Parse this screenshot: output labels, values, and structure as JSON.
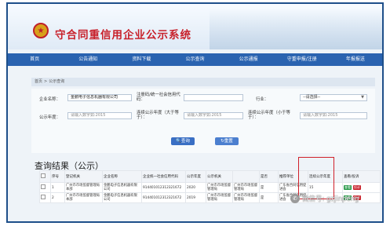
{
  "header": {
    "emblem_glyph": "★",
    "title": "守合同重信用企业公示系统"
  },
  "nav": {
    "items": [
      "首页",
      "公告通知",
      "资料下载",
      "公示查询",
      "公示通报",
      "守重申报/注册",
      "年报报送"
    ]
  },
  "breadcrumb": {
    "home": "首页",
    "separator": ">",
    "current": "公示查询"
  },
  "form": {
    "company_name_label": "企业名称：",
    "company_name_value": "金鹏电子信息机器有限公司",
    "credit_code_label": "注册码/统一社会信用代码：",
    "credit_code_value": "",
    "industry_label": "行业：",
    "industry_value": "--请选择--",
    "year_label": "公示年度：",
    "year_placeholder": "请输入数字如:2015",
    "consecutive_ge_label": "连续公示年度（大于等于）：",
    "consecutive_ge_placeholder": "请输入数字如:2015",
    "consecutive_le_label": "连续公示年度（小于等于）：",
    "consecutive_le_placeholder": "请输入数字如:2015",
    "search_label": "查询",
    "reset_label": "重置"
  },
  "results": {
    "title": "查询结果（公示）",
    "columns": [
      "序号",
      "登记机关",
      "企业名称",
      "企业统一社会信用代码",
      "公示年度",
      "公示机关",
      "",
      "是否",
      "推荐单位",
      "连续公示年度",
      "查看/投诉"
    ],
    "rows": [
      {
        "no": "1",
        "reg": "广州市市场监督管理局本部",
        "name": "金鹏电子信息机器有限公司",
        "code": "914401012312321672",
        "year": "2020",
        "org": "广州市市场监督管理局",
        "org2": "广州市市场监督管理局",
        "flag": "是",
        "rec": "广东省合同信用促进会",
        "cont": "15",
        "view": "查看",
        "complain": "投诉"
      },
      {
        "no": "2",
        "reg": "广州市市场监督管理局本部",
        "name": "金鹏电子信息机器有限公司",
        "code": "914401012312321672",
        "year": "2019",
        "org": "广州市市场监督管理局",
        "org2": "广州市市场监督管理局",
        "flag": "是",
        "rec": "广东省合同信用促进会",
        "cont": "",
        "view": "查看",
        "complain": "投诉"
      }
    ]
  },
  "watermark": {
    "text": "微信号: gzjinpeng"
  },
  "colors": {
    "nav_bg": "#2a63b0",
    "title_red": "#c8202a",
    "frame_blue": "#1e4f8a",
    "highlight_red": "#d0202a"
  }
}
